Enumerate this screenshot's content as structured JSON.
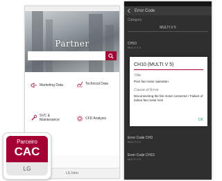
{
  "left_app": {
    "hero_title": "Partner",
    "search": {
      "placeholder": ""
    },
    "menu": [
      {
        "label": "Marketing Data",
        "icon": "megaphone-icon"
      },
      {
        "label": "Technical Data",
        "icon": "chart-icon"
      },
      {
        "label": "SVC & Maintenance",
        "icon": "wrench-icon"
      },
      {
        "label": "CFD Analysis",
        "icon": "gear-icon"
      }
    ],
    "footer": "LG Intro"
  },
  "right_app": {
    "header_title": "Error Code",
    "category_label": "Category",
    "category_value": "MULTI V 5",
    "rows": [
      {
        "code": "CH10",
        "desc": "MULTI V 5"
      },
      {
        "code": "Error Code CH3",
        "desc": "MULTI V 5"
      },
      {
        "code": "Error Code CH10",
        "desc": "MULTI V 5"
      }
    ],
    "dialog": {
      "title": "CH10 (MULTI V 5)",
      "title_label": "Title",
      "title_text": "Poor fan motor operation",
      "cause_label": "Cause of Error",
      "cause_text": "Disconnecting the fan motor connector / Failure of indoor fan motor lock",
      "ok": "OK"
    }
  },
  "badge": {
    "line1": "Parceiro",
    "line2": "CAC",
    "line3": "LG"
  },
  "colors": {
    "brand": "#a50034",
    "accent": "#2e9e8f"
  }
}
